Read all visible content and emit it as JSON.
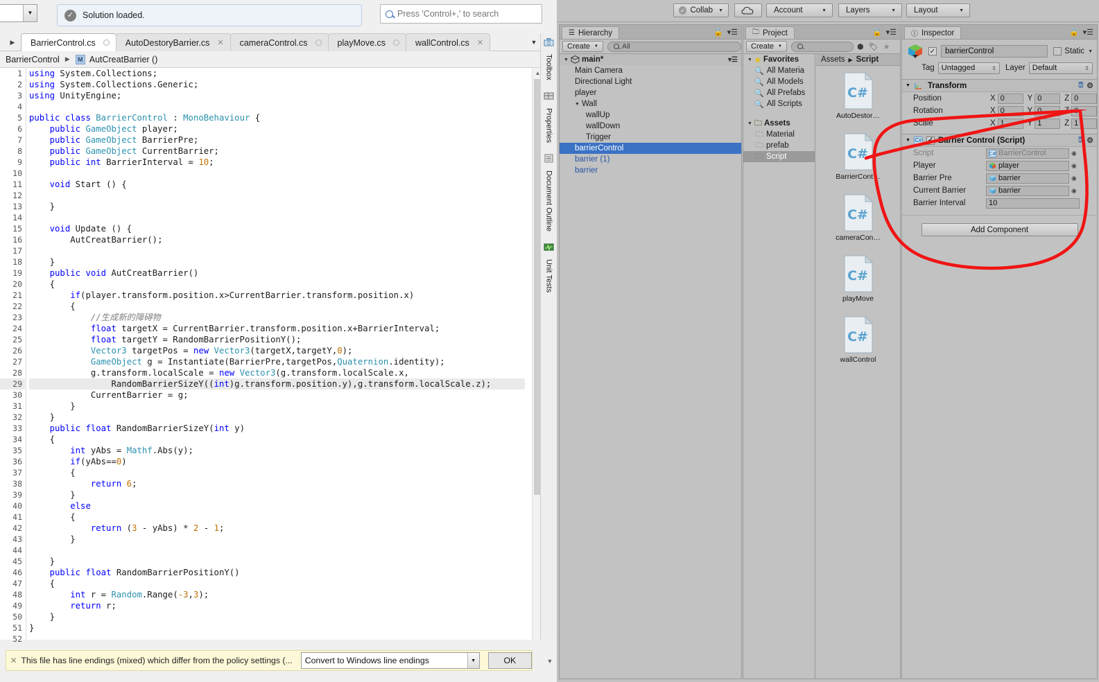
{
  "vs": {
    "status_text": "Solution loaded.",
    "status_icon": "check-circle-icon",
    "search_placeholder": "Press 'Control+,' to search",
    "tabs": [
      {
        "label": "BarrierControl.cs",
        "close": "dot",
        "active": true
      },
      {
        "label": "AutoDestoryBarrier.cs",
        "close": "x",
        "active": false
      },
      {
        "label": "cameraControl.cs",
        "close": "dot",
        "active": false
      },
      {
        "label": "playMove.cs",
        "close": "dot",
        "active": false
      },
      {
        "label": "wallControl.cs",
        "close": "x",
        "active": false
      }
    ],
    "breadcrumb": {
      "class_name": "BarrierControl",
      "member_badge": "M",
      "member_name": "AutCreatBarrier ()"
    },
    "side_tabs": [
      {
        "label": "Toolbox",
        "icon": "toolbox-icon"
      },
      {
        "label": "Properties",
        "icon": "properties-icon"
      },
      {
        "label": "Document Outline",
        "icon": "document-outline-icon"
      },
      {
        "label": "Unit Tests",
        "icon": "unit-tests-icon"
      }
    ],
    "notify": {
      "message": "This file has line endings (mixed) which differ from the policy settings (...",
      "select_value": "Convert to Windows line endings",
      "ok_label": "OK",
      "close_icon": "close-icon"
    },
    "code_lines": [
      {
        "n": 1,
        "html": "<span class='k'>using</span> System.Collections;"
      },
      {
        "n": 2,
        "html": "<span class='k'>using</span> System.Collections.Generic;"
      },
      {
        "n": 3,
        "html": "<span class='k'>using</span> UnityEngine;"
      },
      {
        "n": 4,
        "html": ""
      },
      {
        "n": 5,
        "html": "<span class='k'>public</span> <span class='k'>class</span> <span class='t'>BarrierControl</span> : <span class='t'>MonoBehaviour</span> {"
      },
      {
        "n": 6,
        "html": "    <span class='k'>public</span> <span class='t'>GameObject</span> player;"
      },
      {
        "n": 7,
        "html": "    <span class='k'>public</span> <span class='t'>GameObject</span> BarrierPre;"
      },
      {
        "n": 8,
        "html": "    <span class='k'>public</span> <span class='t'>GameObject</span> CurrentBarrier;"
      },
      {
        "n": 9,
        "html": "    <span class='k'>public</span> <span class='k'>int</span> BarrierInterval = <span class='n'>10</span>;"
      },
      {
        "n": 10,
        "html": ""
      },
      {
        "n": 11,
        "html": "    <span class='k'>void</span> Start () {"
      },
      {
        "n": 12,
        "html": ""
      },
      {
        "n": 13,
        "html": "    }"
      },
      {
        "n": 14,
        "html": ""
      },
      {
        "n": 15,
        "html": "    <span class='k'>void</span> Update () {"
      },
      {
        "n": 16,
        "html": "        AutCreatBarrier();"
      },
      {
        "n": 17,
        "html": ""
      },
      {
        "n": 18,
        "html": "    }"
      },
      {
        "n": 19,
        "html": "    <span class='k'>public</span> <span class='k'>void</span> AutCreatBarrier()"
      },
      {
        "n": 20,
        "html": "    {"
      },
      {
        "n": 21,
        "html": "        <span class='k'>if</span>(player.transform.position.x&gt;CurrentBarrier.transform.position.x)"
      },
      {
        "n": 22,
        "html": "        {"
      },
      {
        "n": 23,
        "html": "            <span class='c'>//生成新的障碍物</span>"
      },
      {
        "n": 24,
        "html": "            <span class='k'>float</span> targetX = CurrentBarrier.transform.position.x+BarrierInterval;"
      },
      {
        "n": 25,
        "html": "            <span class='k'>float</span> targetY = RandomBarrierPositionY();"
      },
      {
        "n": 26,
        "html": "            <span class='t'>Vector3</span> targetPos = <span class='k'>new</span> <span class='t'>Vector3</span>(targetX,targetY,<span class='n'>0</span>);"
      },
      {
        "n": 27,
        "html": "            <span class='t'>GameObject</span> g = Instantiate(BarrierPre,targetPos,<span class='t'>Quaternion</span>.identity);"
      },
      {
        "n": 28,
        "html": "            g.transform.localScale = <span class='k'>new</span> <span class='t'>Vector3</span>(g.transform.localScale.x,"
      },
      {
        "n": 29,
        "html": "                RandomBarrierSizeY((<span class='k'>int</span>)g.transform.position.y),g.transform.localScale.z);",
        "hl": true
      },
      {
        "n": 30,
        "html": "            CurrentBarrier = g;"
      },
      {
        "n": 31,
        "html": "        }"
      },
      {
        "n": 32,
        "html": "    }"
      },
      {
        "n": 33,
        "html": "    <span class='k'>public</span> <span class='k'>float</span> RandomBarrierSizeY(<span class='k'>int</span> y)"
      },
      {
        "n": 34,
        "html": "    {"
      },
      {
        "n": 35,
        "html": "        <span class='k'>int</span> yAbs = <span class='t'>Mathf</span>.Abs(y);"
      },
      {
        "n": 36,
        "html": "        <span class='k'>if</span>(yAbs==<span class='n'>0</span>)"
      },
      {
        "n": 37,
        "html": "        {"
      },
      {
        "n": 38,
        "html": "            <span class='k'>return</span> <span class='n'>6</span>;"
      },
      {
        "n": 39,
        "html": "        }"
      },
      {
        "n": 40,
        "html": "        <span class='k'>else</span>"
      },
      {
        "n": 41,
        "html": "        {"
      },
      {
        "n": 42,
        "html": "            <span class='k'>return</span> (<span class='n'>3</span> - yAbs) * <span class='n'>2</span> - <span class='n'>1</span>;"
      },
      {
        "n": 43,
        "html": "        }"
      },
      {
        "n": 44,
        "html": ""
      },
      {
        "n": 45,
        "html": "    }"
      },
      {
        "n": 46,
        "html": "    <span class='k'>public</span> <span class='k'>float</span> RandomBarrierPositionY()"
      },
      {
        "n": 47,
        "html": "    {"
      },
      {
        "n": 48,
        "html": "        <span class='k'>int</span> r = <span class='t'>Random</span>.Range(<span class='n'>-3</span>,<span class='n'>3</span>);"
      },
      {
        "n": 49,
        "html": "        <span class='k'>return</span> r;"
      },
      {
        "n": 50,
        "html": "    }"
      },
      {
        "n": 51,
        "html": "}"
      },
      {
        "n": 52,
        "html": ""
      }
    ]
  },
  "unity": {
    "toolbar": {
      "collab": "Collab",
      "cloud_icon": "cloud-icon",
      "account": "Account",
      "layers": "Layers",
      "layout": "Layout"
    },
    "hierarchy": {
      "tab": "Hierarchy",
      "create": "Create",
      "search_placeholder": "All",
      "scene": "main*",
      "items": [
        {
          "label": "Main Camera",
          "depth": 1,
          "expand": "",
          "selected": false,
          "blue": false
        },
        {
          "label": "Directional Light",
          "depth": 1,
          "expand": "",
          "selected": false,
          "blue": false
        },
        {
          "label": "player",
          "depth": 1,
          "expand": "",
          "selected": false,
          "blue": false
        },
        {
          "label": "Wall",
          "depth": 1,
          "expand": "▼",
          "selected": false,
          "blue": false
        },
        {
          "label": "wallUp",
          "depth": 2,
          "expand": "",
          "selected": false,
          "blue": false
        },
        {
          "label": "wallDown",
          "depth": 2,
          "expand": "",
          "selected": false,
          "blue": false
        },
        {
          "label": "Trigger",
          "depth": 2,
          "expand": "",
          "selected": false,
          "blue": false
        },
        {
          "label": "barrierControl",
          "depth": 1,
          "expand": "",
          "selected": true,
          "blue": false
        },
        {
          "label": "barrier (1)",
          "depth": 1,
          "expand": "",
          "selected": false,
          "blue": true
        },
        {
          "label": "barrier",
          "depth": 1,
          "expand": "",
          "selected": false,
          "blue": true
        }
      ]
    },
    "project": {
      "tab": "Project",
      "create": "Create",
      "search_placeholder": "",
      "toolbar_icons": [
        "filter-type-icon",
        "filter-label-icon",
        "favorite-star-icon"
      ],
      "favorites_label": "Favorites",
      "favorites": [
        "All Materia",
        "All Models",
        "All Prefabs",
        "All Scripts"
      ],
      "assets_label": "Assets",
      "folders": [
        {
          "label": "Material",
          "selected": false
        },
        {
          "label": "prefab",
          "selected": false
        },
        {
          "label": "Script",
          "selected": true
        }
      ],
      "breadcrumb": [
        "Assets",
        "Script"
      ],
      "files": [
        {
          "label": "AutoDestor…",
          "icon": "csharp-script-icon"
        },
        {
          "label": "BarrierCont…",
          "icon": "csharp-script-icon"
        },
        {
          "label": "cameraCon…",
          "icon": "csharp-script-icon"
        },
        {
          "label": "playMove",
          "icon": "csharp-script-icon"
        },
        {
          "label": "wallControl",
          "icon": "csharp-script-icon"
        }
      ]
    },
    "inspector": {
      "tab": "Inspector",
      "object_name": "barrierControl",
      "enabled": true,
      "static_label": "Static",
      "tag_label": "Tag",
      "tag_value": "Untagged",
      "layer_label": "Layer",
      "layer_value": "Default",
      "transform": {
        "title": "Transform",
        "rows": [
          {
            "label": "Position",
            "x": "0",
            "y": "0",
            "z": "0"
          },
          {
            "label": "Rotation",
            "x": "0",
            "y": "0",
            "z": "0"
          },
          {
            "label": "Scale",
            "x": "1",
            "y": "1",
            "z": "1"
          }
        ],
        "axes": [
          "X",
          "Y",
          "Z"
        ]
      },
      "script_component": {
        "title": "Barrier Control (Script)",
        "enabled": true,
        "props": [
          {
            "label": "Script",
            "value": "BarrierControl",
            "icon": "csharp-script-icon",
            "dim": true
          },
          {
            "label": "Player",
            "value": "player",
            "icon": "gameobject-icon",
            "dim": false
          },
          {
            "label": "Barrier Pre",
            "value": "barrier",
            "icon": "prefab-icon",
            "dim": false
          },
          {
            "label": "Current Barrier",
            "value": "barrier",
            "icon": "prefab-icon",
            "dim": false
          },
          {
            "label": "Barrier Interval",
            "value": "10",
            "icon": "",
            "dim": false
          }
        ]
      },
      "add_component": "Add Component"
    },
    "annotation": {
      "shape": "red-hand-drawn-circle",
      "color": "#f01414"
    }
  }
}
